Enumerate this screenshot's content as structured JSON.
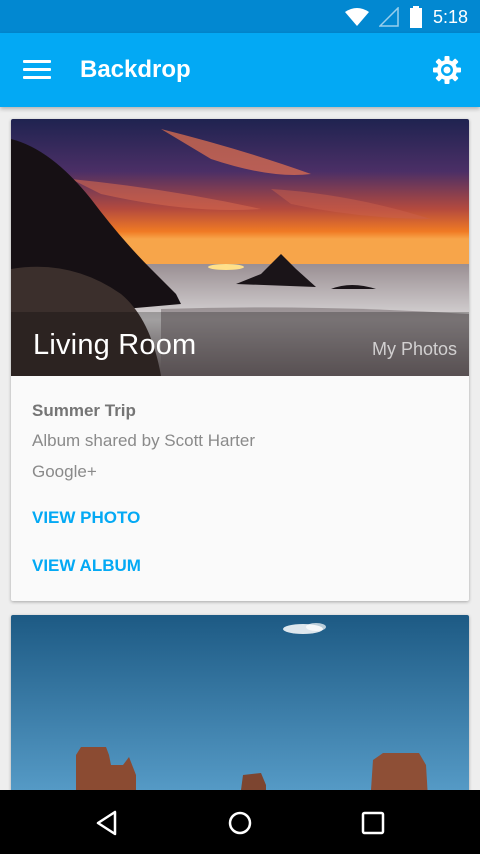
{
  "status_bar": {
    "time": "5:18",
    "icons": [
      "wifi-icon",
      "signal-icon",
      "battery-icon"
    ]
  },
  "app_bar": {
    "title": "Backdrop",
    "menu_icon": "menu-icon",
    "settings_icon": "gear-icon",
    "color": "#03a9f4"
  },
  "cards": [
    {
      "image_title": "Living Room",
      "image_source": "My Photos",
      "album_name": "Summer Trip",
      "album_subtitle": "Album shared by Scott Harter",
      "album_source": "Google+",
      "actions": [
        "VIEW PHOTO",
        "VIEW ALBUM"
      ]
    }
  ],
  "nav_bar": {
    "icons": [
      "back-icon",
      "home-icon",
      "recents-icon"
    ]
  },
  "colors": {
    "status_bar": "#0288d1",
    "accent": "#03a9f4",
    "text_secondary": "#8a8a8a"
  }
}
